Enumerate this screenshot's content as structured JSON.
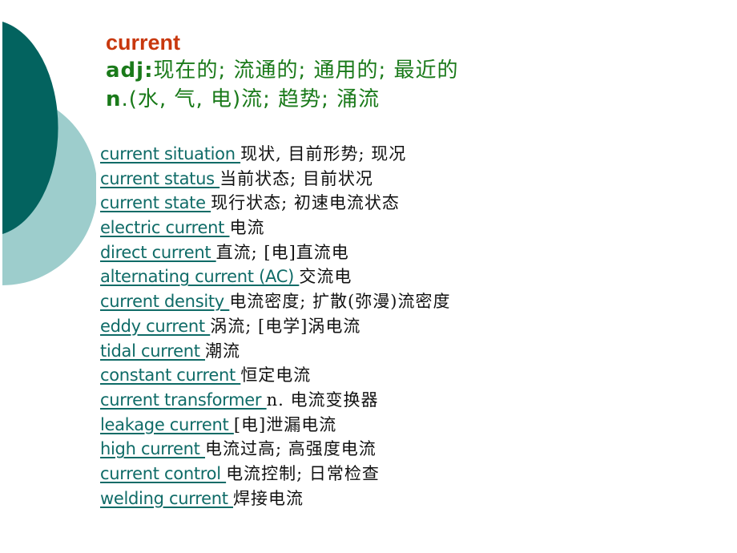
{
  "colors": {
    "title": "#c8380e",
    "definition": "#1a7a1a",
    "term_link": "#0f6b67",
    "gloss": "#111111",
    "deco_dark": "#03635f",
    "deco_light": "#9dcdcc"
  },
  "header": {
    "word": "current",
    "definitions": [
      {
        "pos": "adj",
        "sep": ":",
        "meaning": "现在的; 流通的; 通用的; 最近的"
      },
      {
        "pos": "n",
        "sep": ".",
        "meaning": "(水, 气, 电)流; 趋势; 涌流"
      }
    ]
  },
  "phrases": [
    {
      "term": "current situation ",
      "gloss": "现状, 目前形势; 现况"
    },
    {
      "term": "current status ",
      "gloss": "当前状态; 目前状况"
    },
    {
      "term": "current state ",
      "gloss": "现行状态; 初速电流状态"
    },
    {
      "term": "electric current ",
      "gloss": "电流"
    },
    {
      "term": "direct current ",
      "gloss": "直流; [电]直流电"
    },
    {
      "term": "alternating current (AC) ",
      "gloss": "交流电"
    },
    {
      "term": "current density ",
      "gloss": "电流密度; 扩散(弥漫)流密度"
    },
    {
      "term": "eddy current ",
      "gloss": "涡流; [电学]涡电流"
    },
    {
      "term": "tidal current ",
      "gloss": "潮流"
    },
    {
      "term": "constant current ",
      "gloss": "恒定电流"
    },
    {
      "term": "current transformer ",
      "gloss": "n. 电流变换器"
    },
    {
      "term": "leakage current ",
      "gloss": "[电]泄漏电流"
    },
    {
      "term": "high current ",
      "gloss": "电流过高; 高强度电流"
    },
    {
      "term": "current control ",
      "gloss": "电流控制; 日常检查"
    },
    {
      "term": "welding current ",
      "gloss": "焊接电流"
    }
  ]
}
